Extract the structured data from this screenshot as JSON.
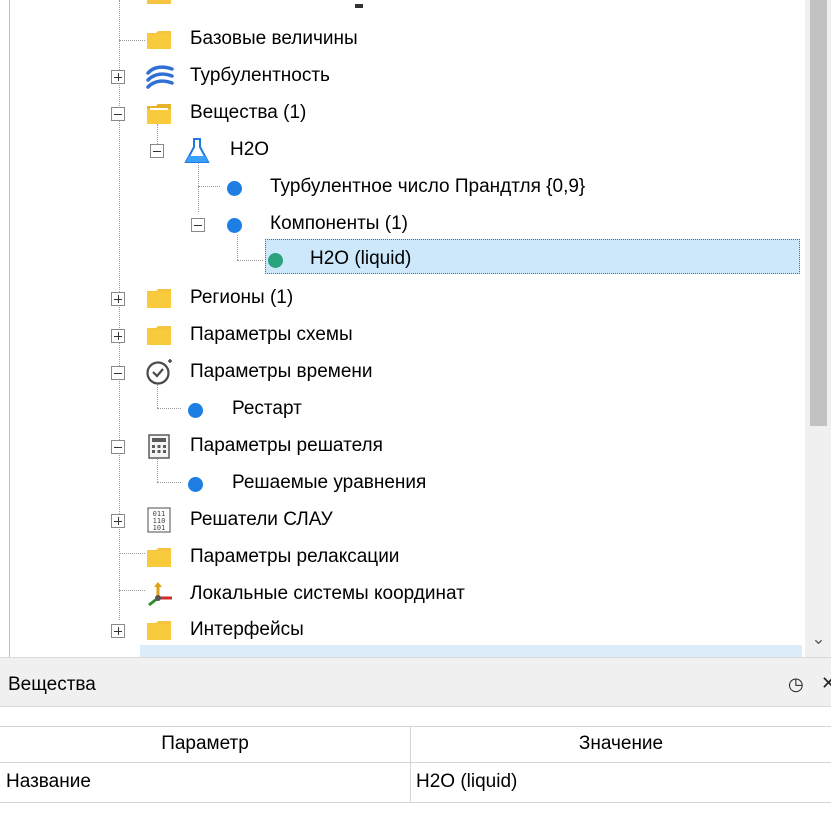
{
  "tree": {
    "items": [
      {
        "id": "base",
        "label": "Базовые величины",
        "icon": "folder-icon",
        "expander": "none"
      },
      {
        "id": "turb",
        "label": "Турбулентность",
        "icon": "turbulence-icon",
        "expander": "plus"
      },
      {
        "id": "subs",
        "label": "Вещества (1)",
        "icon": "folder-open-icon",
        "expander": "minus"
      },
      {
        "id": "h2o",
        "label": "H2O",
        "icon": "flask-icon",
        "expander": "minus"
      },
      {
        "id": "prandtl",
        "label": "Турбулентное число Прандтля {0,9}",
        "icon": "dot-icon",
        "expander": "none"
      },
      {
        "id": "comp",
        "label": "Компоненты (1)",
        "icon": "dot-icon",
        "expander": "minus"
      },
      {
        "id": "h2oliq",
        "label": "H2O (liquid)",
        "icon": "dot-green-icon",
        "expander": "none",
        "selected": true
      },
      {
        "id": "regions",
        "label": "Регионы (1)",
        "icon": "folder-icon",
        "expander": "plus"
      },
      {
        "id": "scheme",
        "label": "Параметры схемы",
        "icon": "folder-icon",
        "expander": "plus"
      },
      {
        "id": "time",
        "label": "Параметры времени",
        "icon": "clock-icon",
        "expander": "minus"
      },
      {
        "id": "restart",
        "label": "Рестарт",
        "icon": "dot-icon",
        "expander": "none"
      },
      {
        "id": "solver",
        "label": "Параметры решателя",
        "icon": "calculator-icon",
        "expander": "minus"
      },
      {
        "id": "equations",
        "label": "Решаемые уравнения",
        "icon": "dot-icon",
        "expander": "none"
      },
      {
        "id": "slau",
        "label": "Решатели СЛАУ",
        "icon": "binary-icon",
        "expander": "plus"
      },
      {
        "id": "relax",
        "label": "Параметры релаксации",
        "icon": "folder-icon",
        "expander": "none"
      },
      {
        "id": "coords",
        "label": "Локальные системы координат",
        "icon": "axes-icon",
        "expander": "none"
      },
      {
        "id": "interfaces",
        "label": "Интерфейсы",
        "icon": "folder-icon",
        "expander": "plus"
      }
    ]
  },
  "properties": {
    "title": "Вещества",
    "col_param": "Параметр",
    "col_value": "Значение",
    "rows": [
      {
        "param": "Название",
        "value": "H2O (liquid)"
      }
    ]
  },
  "colors": {
    "folder": "#f5c542",
    "dot": "#1e7ee3",
    "dot_selected": "#2aa37c",
    "selection": "#cde8fb"
  }
}
